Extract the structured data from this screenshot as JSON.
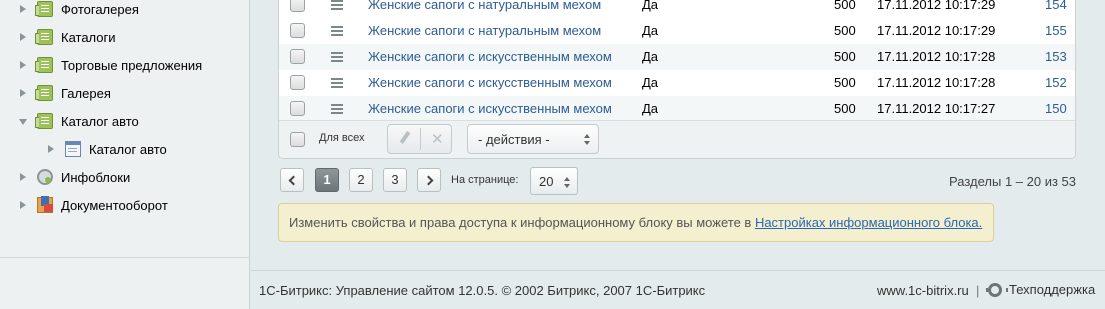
{
  "sidebar": {
    "items": [
      {
        "label": "Фотогалерея"
      },
      {
        "label": "Каталоги"
      },
      {
        "label": "Торговые предложения"
      },
      {
        "label": "Галерея"
      },
      {
        "label": "Каталог авто"
      },
      {
        "label": "Каталог авто"
      },
      {
        "label": "Инфоблоки"
      },
      {
        "label": "Документооборот"
      }
    ]
  },
  "table": {
    "rows": [
      {
        "name": "Женские сапоги с натуральным мехом",
        "active": "Да",
        "sort": "500",
        "date": "17.11.2012 10:17:29",
        "id": "154"
      },
      {
        "name": "Женские сапоги с натуральным мехом",
        "active": "Да",
        "sort": "500",
        "date": "17.11.2012 10:17:29",
        "id": "155"
      },
      {
        "name": "Женские сапоги с искусственным мехом",
        "active": "Да",
        "sort": "500",
        "date": "17.11.2012 10:17:28",
        "id": "153"
      },
      {
        "name": "Женские сапоги с искусственным мехом",
        "active": "Да",
        "sort": "500",
        "date": "17.11.2012 10:17:28",
        "id": "152"
      },
      {
        "name": "Женские сапоги с искусственным мехом",
        "active": "Да",
        "sort": "500",
        "date": "17.11.2012 10:17:27",
        "id": "150"
      }
    ],
    "footer": {
      "for_all": "Для всех",
      "actions": "- действия -"
    }
  },
  "pager": {
    "pages": [
      "1",
      "2",
      "3"
    ],
    "current": "1",
    "per_page_label": "На странице:",
    "per_page": "20",
    "range": "Разделы 1 – 20 из 53"
  },
  "info": {
    "text": "Изменить свойства и права доступа к информационному блоку вы можете в ",
    "link": "Настройках информационного блока."
  },
  "footer": {
    "copyright": "1С-Битрикс: Управление сайтом 12.0.5. © 2002 Битрикс, 2007 1С-Битрикс",
    "site": "www.1c-bitrix.ru",
    "divider": "|",
    "support": "Техподдержка"
  }
}
